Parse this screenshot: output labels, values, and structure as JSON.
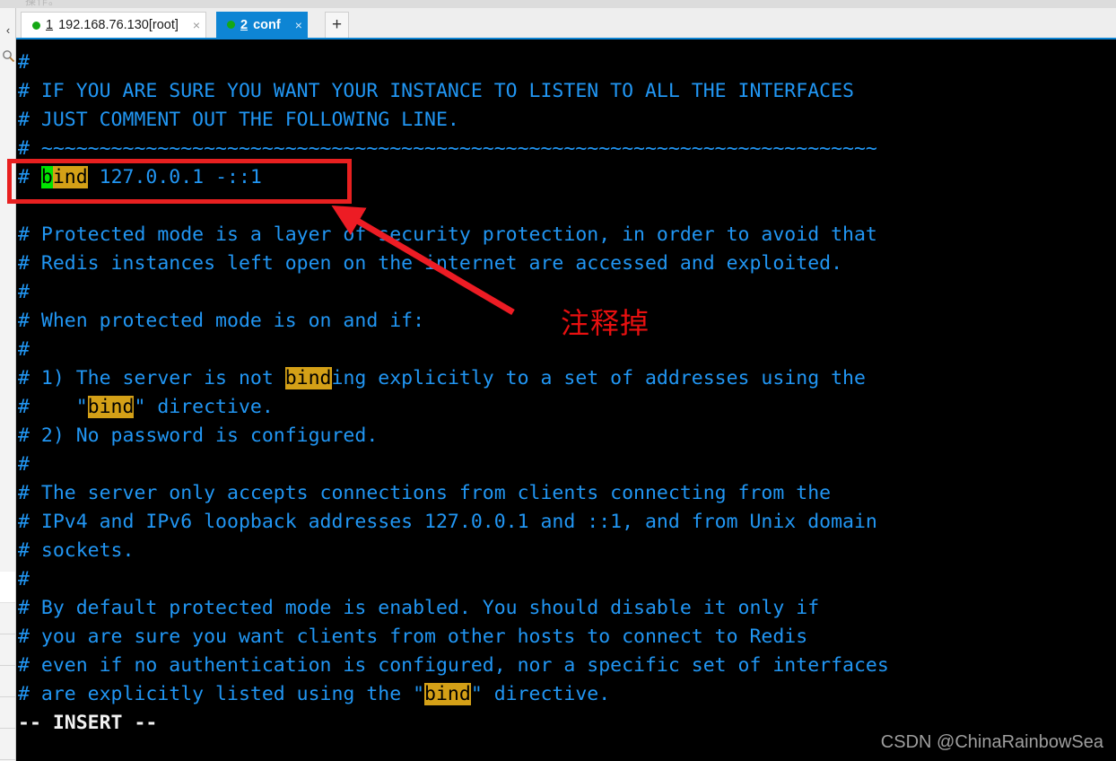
{
  "window": {
    "ghost_text": "操作。"
  },
  "rail": {
    "collapse_icon": "‹",
    "search_icon": "search-icon"
  },
  "tabs": {
    "items": [
      {
        "num": "1",
        "label": " 192.168.76.130[root]",
        "close": "×",
        "active": false
      },
      {
        "num": "2",
        "label": " conf",
        "close": "×",
        "active": true
      }
    ],
    "new_tab_label": "+"
  },
  "terminal": {
    "lines": [
      [
        {
          "t": "#"
        }
      ],
      [
        {
          "t": "# IF YOU ARE SURE YOU WANT YOUR INSTANCE TO LISTEN TO ALL THE INTERFACES"
        }
      ],
      [
        {
          "t": "# JUST COMMENT OUT THE FOLLOWING LINE."
        }
      ],
      [
        {
          "t": "# ~~~~~~~~~~~~~~~~~~~~~~~~~~~~~~~~~~~~~~~~~~~~~~~~~~~~~~~~~~~~~~~~~~~~~~~~"
        }
      ],
      [
        {
          "t": "# "
        },
        {
          "t": "b",
          "s": "cursor"
        },
        {
          "t": "ind",
          "s": "hl"
        },
        {
          "t": " 127.0.0.1 -::1"
        }
      ],
      [
        {
          "t": ""
        }
      ],
      [
        {
          "t": "# Protected mode is a layer of security protection, in order to avoid that"
        }
      ],
      [
        {
          "t": "# Redis instances left open on the internet are accessed and exploited."
        }
      ],
      [
        {
          "t": "#"
        }
      ],
      [
        {
          "t": "# When protected mode is on and if:"
        }
      ],
      [
        {
          "t": "#"
        }
      ],
      [
        {
          "t": "# 1) The server is not "
        },
        {
          "t": "bind",
          "s": "hl"
        },
        {
          "t": "ing explicitly to a set of addresses using the"
        }
      ],
      [
        {
          "t": "#    \""
        },
        {
          "t": "bind",
          "s": "hl"
        },
        {
          "t": "\" directive."
        }
      ],
      [
        {
          "t": "# 2) No password is configured."
        }
      ],
      [
        {
          "t": "#"
        }
      ],
      [
        {
          "t": "# The server only accepts connections from clients connecting from the"
        }
      ],
      [
        {
          "t": "# IPv4 and IPv6 loopback addresses 127.0.0.1 and ::1, and from Unix domain"
        }
      ],
      [
        {
          "t": "# sockets."
        }
      ],
      [
        {
          "t": "#"
        }
      ],
      [
        {
          "t": "# By default protected mode is enabled. You should disable it only if"
        }
      ],
      [
        {
          "t": "# you are sure you want clients from other hosts to connect to Redis"
        }
      ],
      [
        {
          "t": "# even if no authentication is configured, nor a specific set of interfaces"
        }
      ],
      [
        {
          "t": "# are explicitly listed using the \""
        },
        {
          "t": "bind",
          "s": "hl"
        },
        {
          "t": "\" directive."
        }
      ],
      [
        {
          "t": "-- INSERT --",
          "s": "insert"
        }
      ]
    ],
    "status_mode": "-- INSERT --"
  },
  "annotations": {
    "note_text": "注释掉",
    "box_color": "#e82020",
    "arrow_color": "#ed1c24"
  },
  "watermark": {
    "text": "CSDN @ChinaRainbowSea"
  },
  "colors": {
    "terminal_bg": "#000000",
    "terminal_fg": "#2196f3",
    "highlight_bg": "#d4a017",
    "cursor_bg": "#00e500",
    "active_tab": "#0e85d4",
    "status_fg": "#f2f2f2"
  }
}
